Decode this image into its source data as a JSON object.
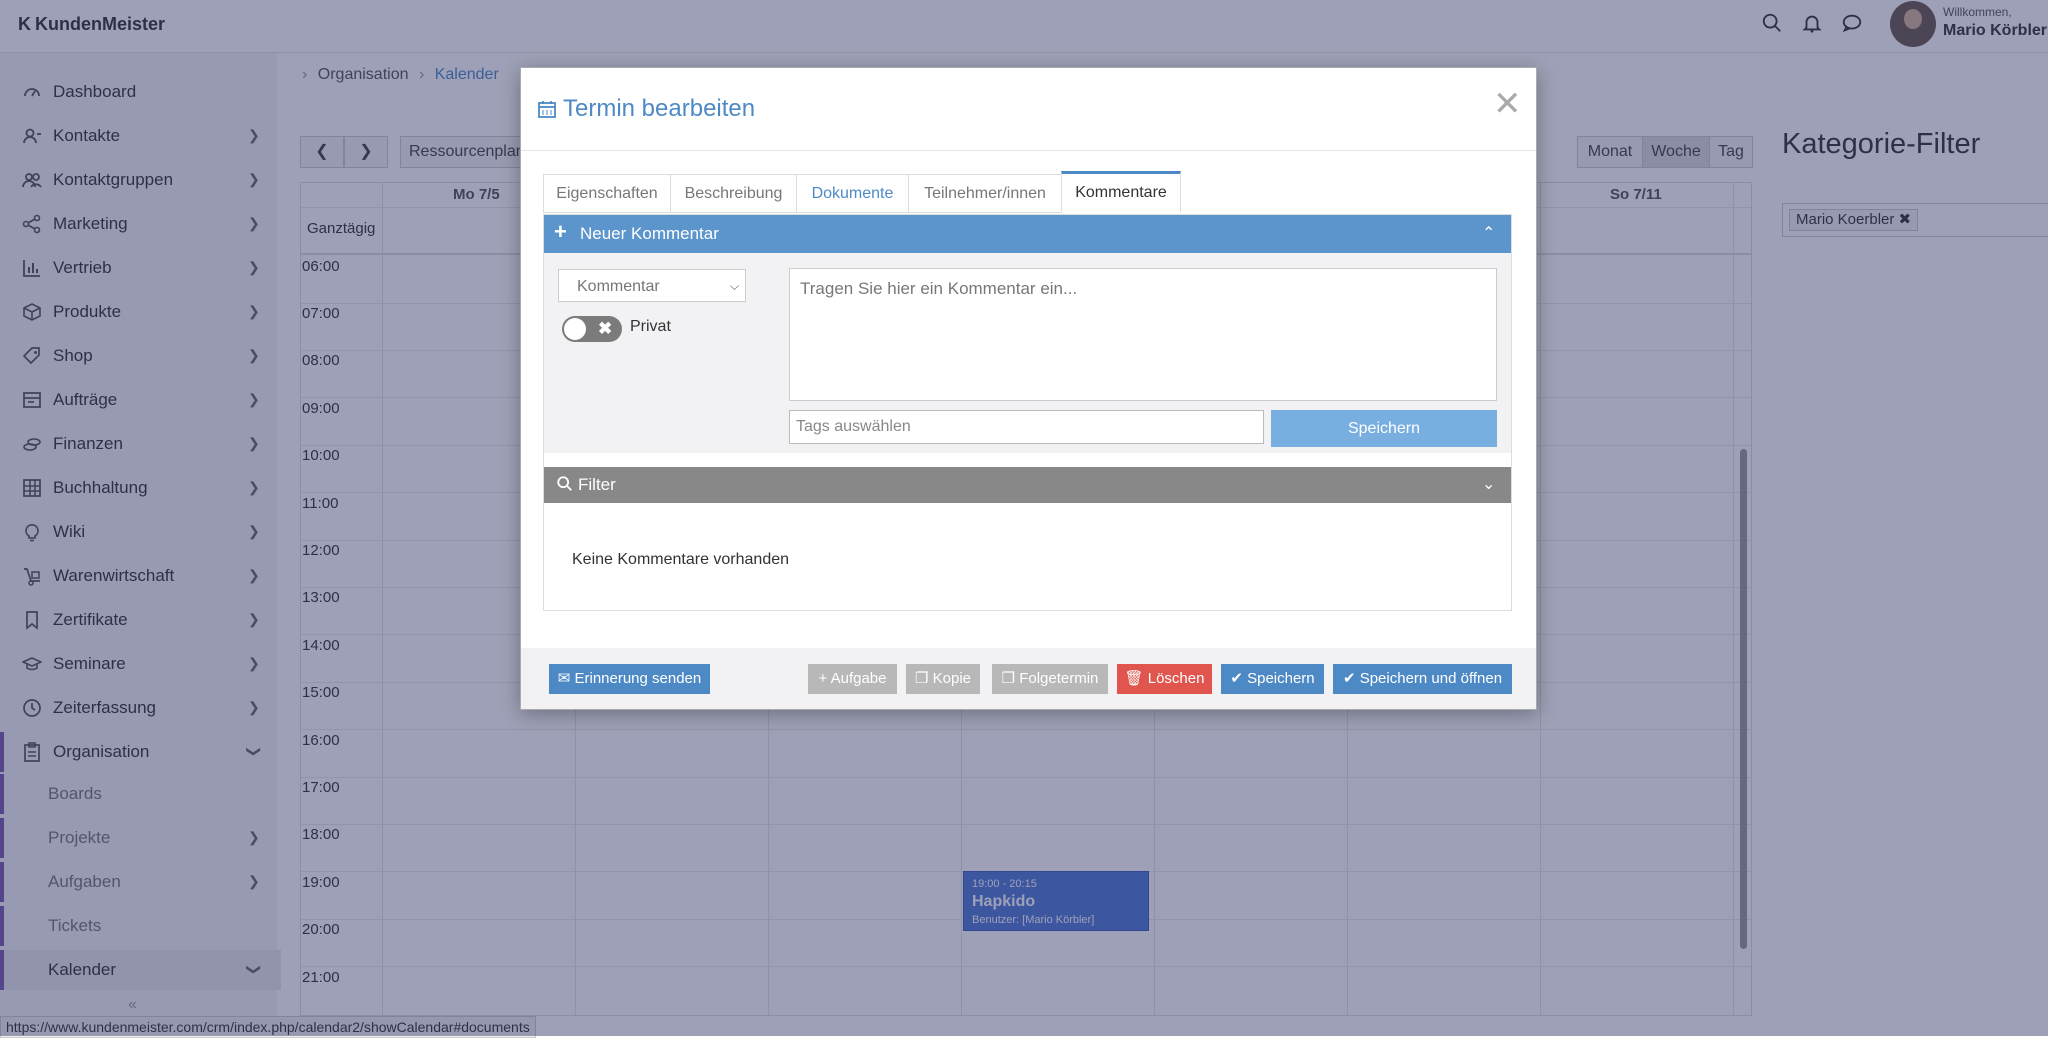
{
  "app": {
    "name": "KundenMeister",
    "welcome": "Willkommen,",
    "user": "Mario Körbler"
  },
  "sidebar": {
    "items": [
      {
        "label": "Dashboard"
      },
      {
        "label": "Kontakte"
      },
      {
        "label": "Kontaktgruppen"
      },
      {
        "label": "Marketing"
      },
      {
        "label": "Vertrieb"
      },
      {
        "label": "Produkte"
      },
      {
        "label": "Shop"
      },
      {
        "label": "Aufträge"
      },
      {
        "label": "Finanzen"
      },
      {
        "label": "Buchhaltung"
      },
      {
        "label": "Wiki"
      },
      {
        "label": "Warenwirtschaft"
      },
      {
        "label": "Zertifikate"
      },
      {
        "label": "Seminare"
      },
      {
        "label": "Zeiterfassung"
      },
      {
        "label": "Organisation"
      }
    ],
    "subitems": [
      {
        "label": "Boards"
      },
      {
        "label": "Projekte"
      },
      {
        "label": "Aufgaben"
      },
      {
        "label": "Tickets"
      },
      {
        "label": "Kalender"
      }
    ]
  },
  "breadcrumb": {
    "parent": "Organisation",
    "current": "Kalender"
  },
  "calendar": {
    "resource_btn": "Ressourcenplan",
    "views": {
      "month": "Monat",
      "week": "Woche",
      "day": "Tag"
    },
    "allday": "Ganztägig",
    "day_headers": {
      "mon": "Mo 7/5",
      "sun": "So 7/11"
    },
    "hours": [
      "06:00",
      "07:00",
      "08:00",
      "09:00",
      "10:00",
      "11:00",
      "12:00",
      "13:00",
      "14:00",
      "15:00",
      "16:00",
      "17:00",
      "18:00",
      "19:00",
      "20:00",
      "21:00"
    ],
    "event": {
      "time": "19:00 - 20:15",
      "name": "Hapkido",
      "user": "Benutzer: [Mario Körbler]"
    }
  },
  "category_filter": {
    "title": "Kategorie-Filter",
    "chip": "Mario Koerbler"
  },
  "status_url": "https://www.kundenmeister.com/crm/index.php/calendar2/showCalendar#documents",
  "modal": {
    "title": "Termin bearbeiten",
    "tabs": [
      "Eigenschaften",
      "Beschreibung",
      "Dokumente",
      "Teilnehmer/innen",
      "Kommentare"
    ],
    "new_comment": "Neuer Kommentar",
    "select_value": "Kommentar",
    "privat": "Privat",
    "textarea_placeholder": "Tragen Sie hier ein Kommentar ein...",
    "tags_placeholder": "Tags auswählen",
    "save": "Speichern",
    "filter": "Filter",
    "empty": "Keine Kommentare vorhanden",
    "footer": {
      "reminder": "Erinnerung senden",
      "task": "Aufgabe",
      "copy": "Kopie",
      "followup": "Folgetermin",
      "delete": "Löschen",
      "save": "Speichern",
      "save_open": "Speichern und öffnen"
    }
  }
}
